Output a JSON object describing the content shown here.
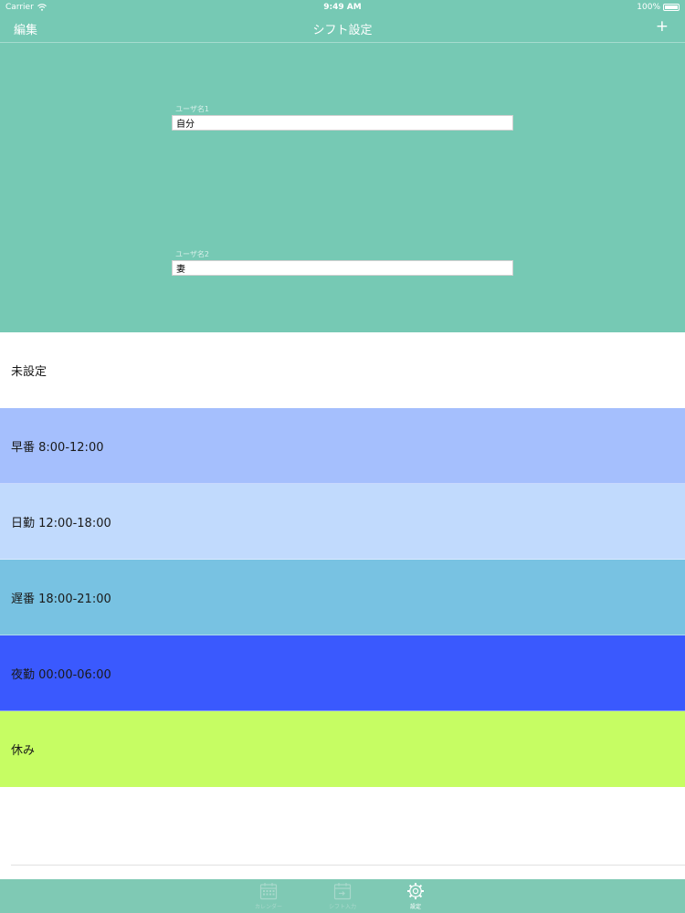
{
  "status_bar": {
    "carrier": "Carrier",
    "time": "9:49 AM",
    "battery": "100%"
  },
  "navbar": {
    "left_label": "編集",
    "title": "シフト設定",
    "right_label": "+"
  },
  "users": [
    {
      "label": "ユーザ名1",
      "value": "自分"
    },
    {
      "label": "ユーザ名2",
      "value": "妻"
    }
  ],
  "shifts": [
    {
      "label": "未設定",
      "color": "#ffffff"
    },
    {
      "label": "早番 8:00-12:00",
      "color": "#a5bffd"
    },
    {
      "label": "日勤 12:00-18:00",
      "color": "#c1dafd"
    },
    {
      "label": "遅番 18:00-21:00",
      "color": "#78c2e2"
    },
    {
      "label": "夜勤 00:00-06:00",
      "color": "#3a59fe"
    },
    {
      "label": "休み",
      "color": "#c6fd63"
    }
  ],
  "tabbar": {
    "tabs": [
      {
        "label": "カレンダー",
        "icon": "calendar-icon",
        "active": false
      },
      {
        "label": "シフト入力",
        "icon": "calendar-edit-icon",
        "active": false
      },
      {
        "label": "設定",
        "icon": "gear-icon",
        "active": true
      }
    ]
  },
  "colors": {
    "header": "#76c9b4",
    "tabbar": "#7fc9b4"
  }
}
